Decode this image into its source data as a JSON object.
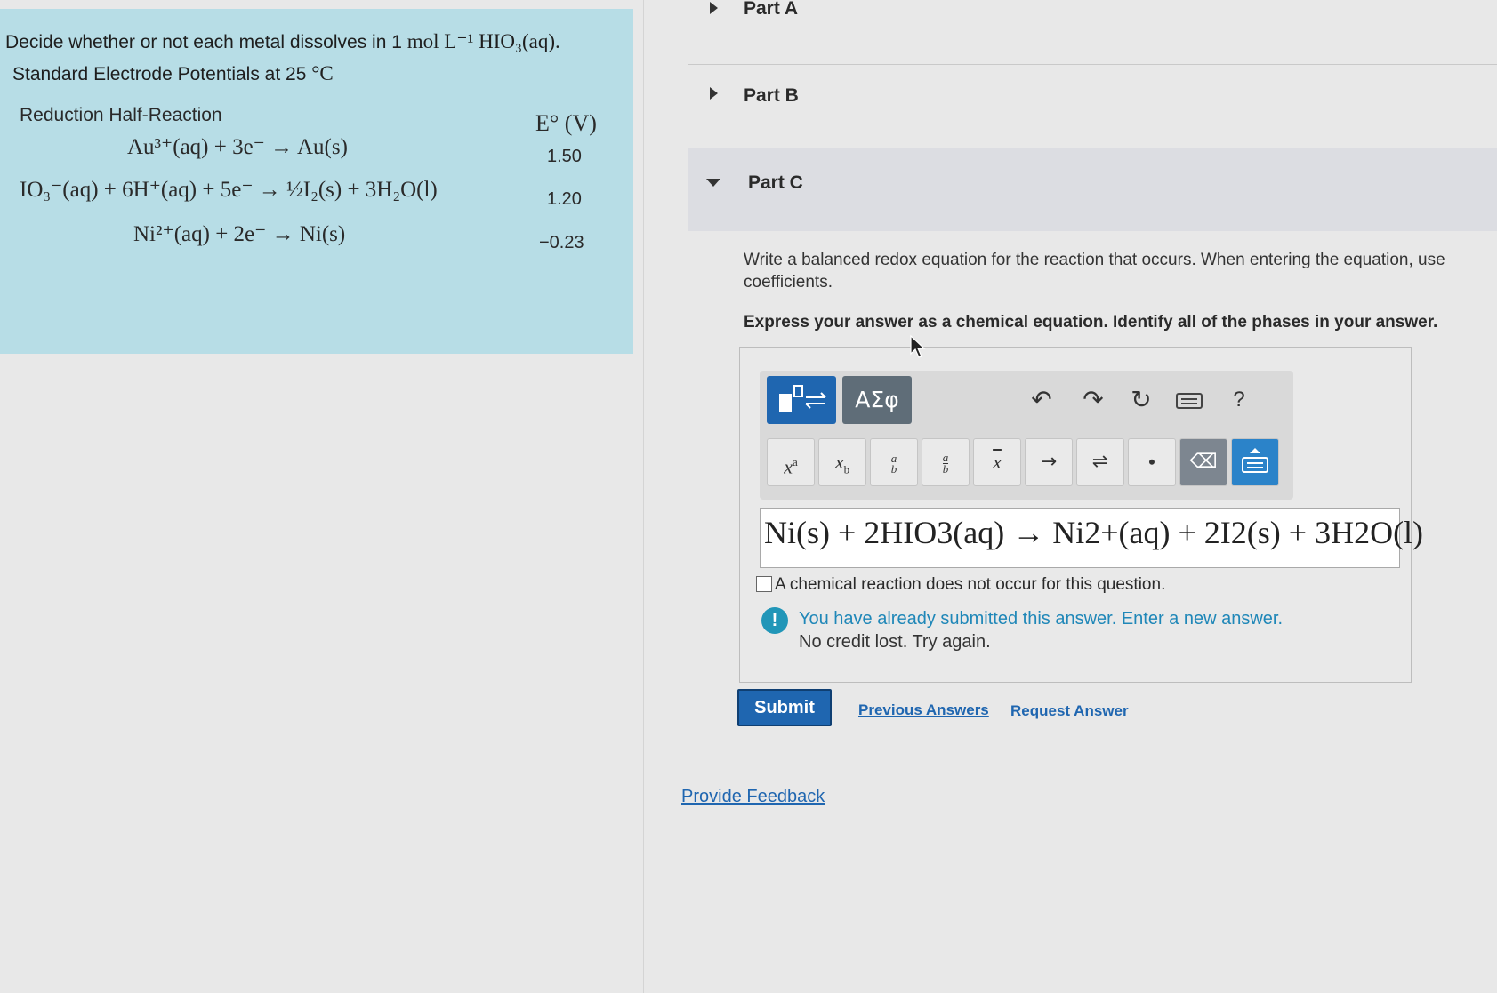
{
  "question": {
    "text": "Decide whether or not each metal dissolves in 1",
    "math": "mol L⁻¹ HIO₃(aq)."
  },
  "table": {
    "caption": "Standard Electrode Potentials at 25",
    "caption_unit": "°C",
    "col_reaction": "Reduction Half-Reaction",
    "col_potential": "E° (V)",
    "rows": [
      {
        "reaction": "Au³⁺(aq) + 3e⁻ → Au(s)",
        "potential": "1.50"
      },
      {
        "reaction": "IO₃⁻(aq) + 6H⁺(aq) + 5e⁻ → ½I₂(s) + 3H₂O(l)",
        "potential": "1.20"
      },
      {
        "reaction": "Ni²⁺(aq) + 2e⁻ → Ni(s)",
        "potential": "−0.23"
      }
    ]
  },
  "parts": [
    {
      "label": "Part A",
      "expanded": false
    },
    {
      "label": "Part B",
      "expanded": false
    },
    {
      "label": "Part C",
      "expanded": true
    }
  ],
  "partC": {
    "instruction": "Write a balanced redox equation for the reaction that occurs. When entering the equation, use coefficients.",
    "express": "Express your answer as a chemical equation. Identify all of the phases in your answer.",
    "toolbar": {
      "greek_label": "ΑΣφ",
      "help_label": "?",
      "keys": [
        "xᵃ",
        "x_b",
        "a/b",
        "a/b",
        "x̄",
        "→",
        "⇌",
        "•",
        "⌫",
        "keyboard"
      ]
    },
    "answer": "Ni(s) + 2HIO3(aq) → Ni2+(aq) + 2I2(s) + 3H2O(l)",
    "no_reaction_label": "A chemical reaction does not occur for this question.",
    "alert_line1": "You have already submitted this answer. Enter a new answer.",
    "alert_line2": "No credit lost. Try again.",
    "submit_label": "Submit",
    "previous_answers_label": "Previous Answers",
    "request_answer_label": "Request Answer"
  },
  "feedback_label": "Provide Feedback",
  "colors": {
    "panel_bg": "#b7dde6",
    "primary": "#1f66b0",
    "alert": "#2196b8"
  }
}
